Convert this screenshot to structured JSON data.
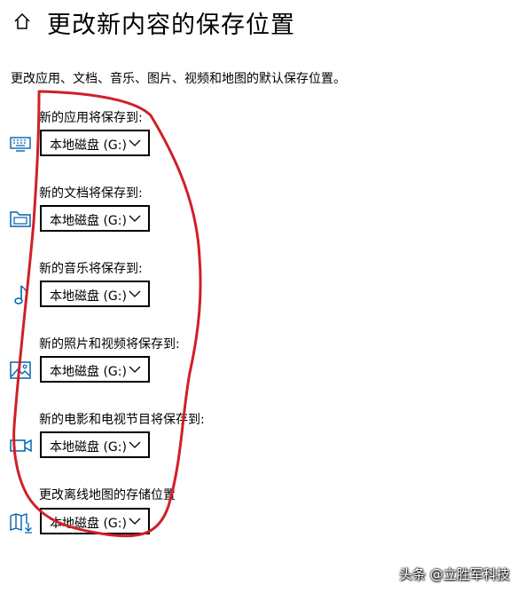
{
  "header": {
    "title": "更改新内容的保存位置",
    "home_icon": "home-icon"
  },
  "description": "更改应用、文档、音乐、图片、视频和地图的默认保存位置。",
  "settings": [
    {
      "label": "新的应用将保存到:",
      "value": "本地磁盘 (G:)",
      "icon": "keyboard-icon"
    },
    {
      "label": "新的文档将保存到:",
      "value": "本地磁盘 (G:)",
      "icon": "documents-icon"
    },
    {
      "label": "新的音乐将保存到:",
      "value": "本地磁盘 (G:)",
      "icon": "music-note-icon"
    },
    {
      "label": "新的照片和视频将保存到:",
      "value": "本地磁盘 (G:)",
      "icon": "picture-icon"
    },
    {
      "label": "新的电影和电视节目将保存到:",
      "value": "本地磁盘 (G:)",
      "icon": "video-camera-icon"
    },
    {
      "label": "更改离线地图的存储位置",
      "value": "本地磁盘 (G:)",
      "icon": "map-download-icon"
    }
  ],
  "colors": {
    "accent": "#0063b1",
    "annotation": "#d11f27"
  },
  "watermark": "头条 @立胜军科技"
}
